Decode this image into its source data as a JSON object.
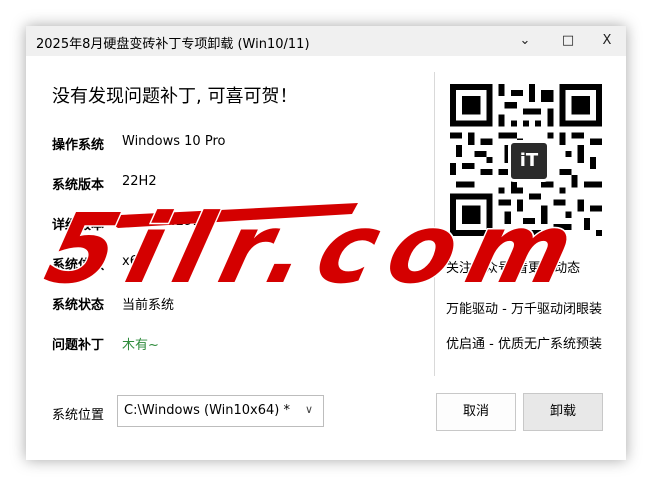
{
  "window": {
    "title": "2025年8月硬盘变砖补丁专项卸载 (Win10/11)",
    "minimize_glyph": "⌄",
    "maximize_glyph": "□",
    "close_glyph": "X"
  },
  "main": {
    "headline": "没有发现问题补丁, 可喜可贺！",
    "info": [
      {
        "label": "操作系统",
        "value": "Windows 10 Pro"
      },
      {
        "label": "系统版本",
        "value": "22H2"
      },
      {
        "label": "详细版本",
        "value": "19045.4291"
      },
      {
        "label": "系统位数",
        "value": "x64"
      },
      {
        "label": "系统状态",
        "value": "当前系统"
      },
      {
        "label": "问题补丁",
        "value": "木有~"
      }
    ]
  },
  "sidebar": {
    "qr_logo_text": "iT",
    "lines": [
      "关注公众号 看更新动态",
      "万能驱动 - 万千驱动闭眼装",
      "优启通 - 优质无广系统预装"
    ]
  },
  "footer": {
    "location_label": "系统位置",
    "location_value": "C:\\Windows (Win10x64) *",
    "cancel_label": "取消",
    "uninstall_label": "卸载"
  },
  "watermark": {
    "text": "5ilr.com"
  },
  "colors": {
    "titlebar": "#f0f0f0",
    "status_green": "#2e8b3c",
    "watermark_red": "#d40000"
  }
}
